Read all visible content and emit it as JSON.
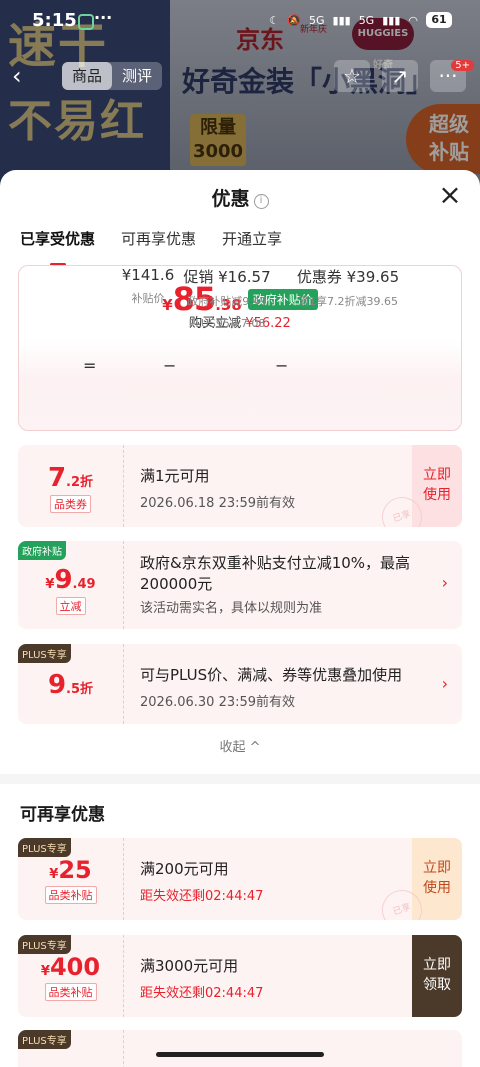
{
  "status": {
    "time": "5:15",
    "battery": "61",
    "net1": "5G",
    "net2": "5G"
  },
  "background": {
    "big1": "速干",
    "big2": "不易红",
    "brand": "京东",
    "brand_sub": "新年庆",
    "huggies": "HUGGIES 好奇",
    "title": "好奇金装「小黑洞」",
    "limit_l1": "限量",
    "limit_l2": "3000",
    "super_l1": "超级",
    "super_l2": "补贴"
  },
  "nav": {
    "tab_product": "商品",
    "tab_review": "测评",
    "badge": "5+"
  },
  "sheet": {
    "title": "优惠",
    "info_icon": "i",
    "close": "×",
    "tabs": [
      "已享受优惠",
      "可再享优惠",
      "开通立享"
    ]
  },
  "summary": {
    "currency": "¥",
    "price_int": "85",
    "price_dec": ".38",
    "gov_label": "政府补贴价",
    "buy_text": "购买立减",
    "buy_amount": "¥56.22",
    "eq": "=",
    "minus": "−",
    "col1_v": "¥141.6",
    "col1_l": "补贴价",
    "col2_v": "促销 ¥16.57",
    "col2_l1": "政府补贴减9.49",
    "col2_l2": "PLUS95折7.08",
    "col3_v": "优惠券 ¥39.65",
    "col3_l": "满1享7.2折减39.65"
  },
  "enjoyed": [
    {
      "val_big": "7",
      "val_small": ".2折",
      "tag": "品类券",
      "title": "满1元可用",
      "sub": "2026.06.18 23:59前有效",
      "action": "立即\n使用",
      "stamp": "已享"
    },
    {
      "corner": "政府补贴",
      "val_yen": "¥",
      "val_big": "9",
      "val_small": ".49",
      "tag": "立减",
      "title": "政府&京东双重补贴支付立减10%，最高200000元",
      "sub": "该活动需实名，具体以规则为准",
      "chev": "›"
    },
    {
      "corner": "PLUS专享",
      "val_big": "9",
      "val_small": ".5折",
      "title": "可与PLUS价、满减、券等优惠叠加使用",
      "sub": "2026.06.30 23:59前有效",
      "chev": "›"
    }
  ],
  "collapse": "收起 ^",
  "more": {
    "title": "可再享优惠",
    "items": [
      {
        "corner": "PLUS专享",
        "val_yen": "¥",
        "val_big": "25",
        "tag": "品类补贴",
        "title": "满200元可用",
        "sub": "距失效还剩02:44:47",
        "action_l1": "立即",
        "action_l2": "使用",
        "stamp": "已享"
      },
      {
        "corner": "PLUS专享",
        "val_yen": "¥",
        "val_big": "400",
        "tag": "品类补贴",
        "title": "满3000元可用",
        "sub": "距失效还剩02:44:47",
        "action_l1": "立即",
        "action_l2": "领取"
      },
      {
        "corner": "PLUS专享"
      }
    ]
  }
}
